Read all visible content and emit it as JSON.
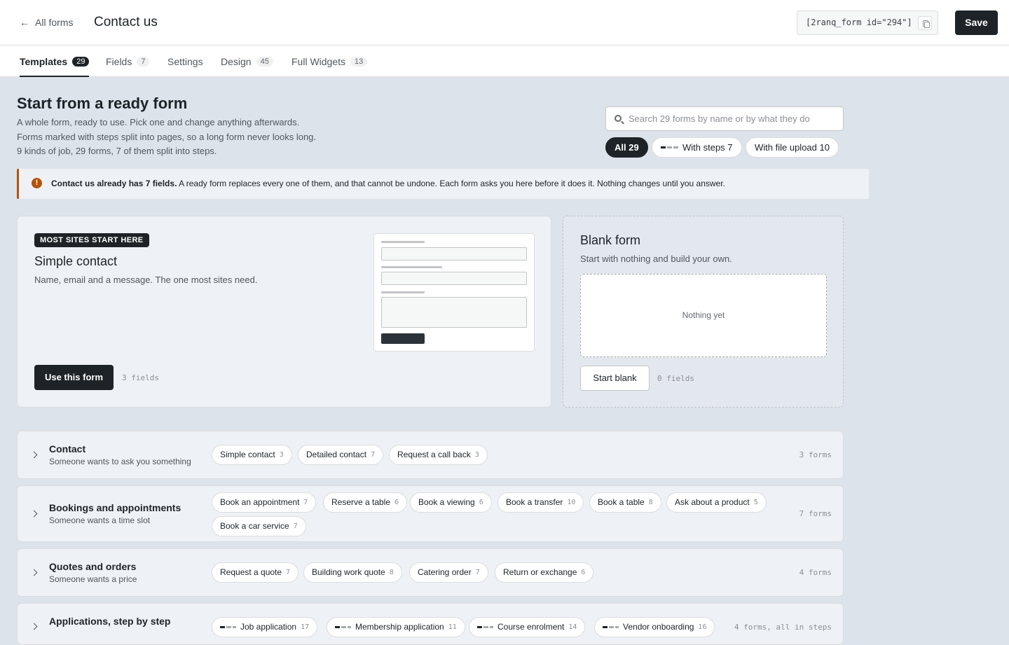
{
  "header": {
    "back_label": "All forms",
    "back_arrow": "←",
    "title": "Contact us",
    "shortcode": "[2ranq_form id=\"294\"]",
    "save_label": "Save"
  },
  "tabs": [
    {
      "label": "Templates",
      "count": "29"
    },
    {
      "label": "Fields",
      "count": "7"
    },
    {
      "label": "Settings",
      "count": ""
    },
    {
      "label": "Design",
      "count": "45"
    },
    {
      "label": "Full Widgets",
      "count": "13"
    }
  ],
  "intro": {
    "title": "Start from a ready form",
    "lines": [
      "A whole form, ready to use. Pick one and change anything afterwards.",
      "Forms marked with steps split into pages, so a long form never looks long.",
      "9 kinds of job, 29 forms, 7 of them split into steps."
    ]
  },
  "search": {
    "placeholder": "Search 29 forms by name or by what they do"
  },
  "filters": [
    {
      "label": "All 29"
    },
    {
      "label": "With steps 7"
    },
    {
      "label": "With file upload 10"
    }
  ],
  "notice": {
    "icon": "!",
    "strong": "Contact us already has 7 fields.",
    "text": " A ready form replaces every one of them, and that cannot be undone. Each form asks you here before it does it. Nothing changes until you answer."
  },
  "featured": {
    "badge": "MOST SITES START HERE",
    "title": "Simple contact",
    "description": "Name, email and a message. The one most sites need.",
    "button": "Use this form",
    "fields": "3 fields"
  },
  "blank": {
    "title": "Blank form",
    "description": "Start with nothing and build your own.",
    "empty": "Nothing yet",
    "button": "Start blank",
    "fields": "0 fields"
  },
  "categories": [
    {
      "title": "Contact",
      "subtitle": "Someone wants to ask you something",
      "count": "3 forms",
      "forms": [
        {
          "name": "Simple contact",
          "n": "3"
        },
        {
          "name": "Detailed contact",
          "n": "7"
        },
        {
          "name": "Request a call back",
          "n": "3"
        }
      ]
    },
    {
      "title": "Bookings and appointments",
      "subtitle": "Someone wants a time slot",
      "count": "7 forms",
      "forms": [
        {
          "name": "Book an appointment",
          "n": "7"
        },
        {
          "name": "Reserve a table",
          "n": "6"
        },
        {
          "name": "Book a viewing",
          "n": "6"
        },
        {
          "name": "Book a transfer",
          "n": "10"
        },
        {
          "name": "Book a table",
          "n": "8"
        },
        {
          "name": "Ask about a product",
          "n": "5"
        },
        {
          "name": "Book a car service",
          "n": "7"
        }
      ]
    },
    {
      "title": "Quotes and orders",
      "subtitle": "Someone wants a price",
      "count": "4 forms",
      "forms": [
        {
          "name": "Request a quote",
          "n": "7"
        },
        {
          "name": "Building work quote",
          "n": "8"
        },
        {
          "name": "Catering order",
          "n": "7"
        },
        {
          "name": "Return or exchange",
          "n": "6"
        }
      ]
    },
    {
      "title": "Applications, step by step",
      "subtitle": "",
      "count": "4 forms, all in steps",
      "forms": [
        {
          "name": "Job application",
          "n": "17"
        },
        {
          "name": "Membership application",
          "n": "11"
        },
        {
          "name": "Course enrolment",
          "n": "14"
        },
        {
          "name": "Vendor onboarding",
          "n": "16"
        }
      ]
    }
  ]
}
